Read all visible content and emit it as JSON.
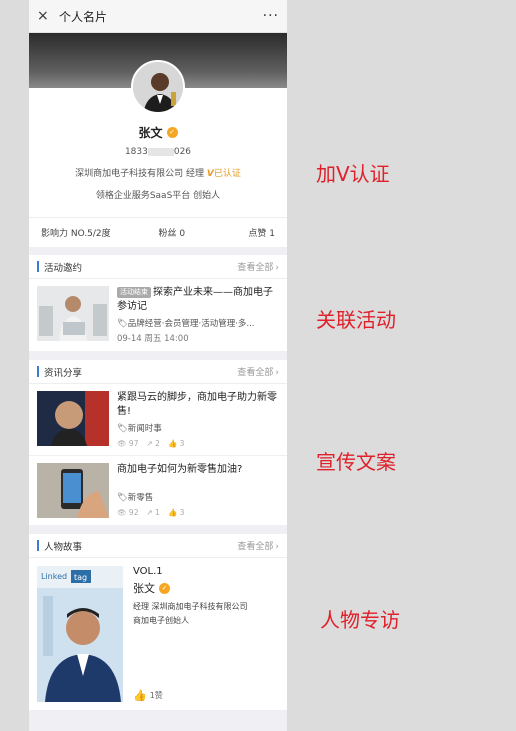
{
  "topbar": {
    "title": "个人名片",
    "close_icon": "×",
    "more_icon": "···"
  },
  "profile": {
    "name": "张文",
    "phone_prefix": "1833",
    "phone_suffix": "026",
    "company": "深圳商加电子科技有限公司",
    "position": "经理",
    "verified_mark": "V",
    "verified_text": "已认证",
    "slogan": "领格企业服务SaaS平台  创始人"
  },
  "stats": {
    "influence": "影响力 NO.5/2度",
    "fans": "粉丝 0",
    "likes": "点赞 1"
  },
  "activity": {
    "header": "活动邀约",
    "view_all": "查看全部",
    "items": [
      {
        "status": "活动结束",
        "title": "探索产业未来——商加电子参访记",
        "tags": "品牌经营·会员管理·活动管理·多...",
        "date": "09-14 周五 14:00"
      }
    ]
  },
  "news": {
    "header": "资讯分享",
    "view_all": "查看全部",
    "items": [
      {
        "title": "紧跟马云的脚步，商加电子助力新零售!",
        "tag": "新闻时事",
        "views": "97",
        "shares": "2",
        "likes": "3"
      },
      {
        "title": "商加电子如何为新零售加油?",
        "tag": "新零售",
        "views": "92",
        "shares": "1",
        "likes": "3"
      }
    ]
  },
  "story": {
    "header": "人物故事",
    "view_all": "查看全部",
    "vol": "VOL.1",
    "name": "张文",
    "line1": "经理 深圳商加电子科技有限公司",
    "line2": "商加电子创始人",
    "likes": "1赞",
    "logo_text_1": "Linked",
    "logo_text_2": "tag"
  },
  "annotations": [
    "加V认证",
    "关联活动",
    "宣传文案",
    "人物专访"
  ],
  "colors": {
    "accent": "#3a7bd5",
    "annotation": "#e0202a",
    "verified": "#e69a23"
  }
}
